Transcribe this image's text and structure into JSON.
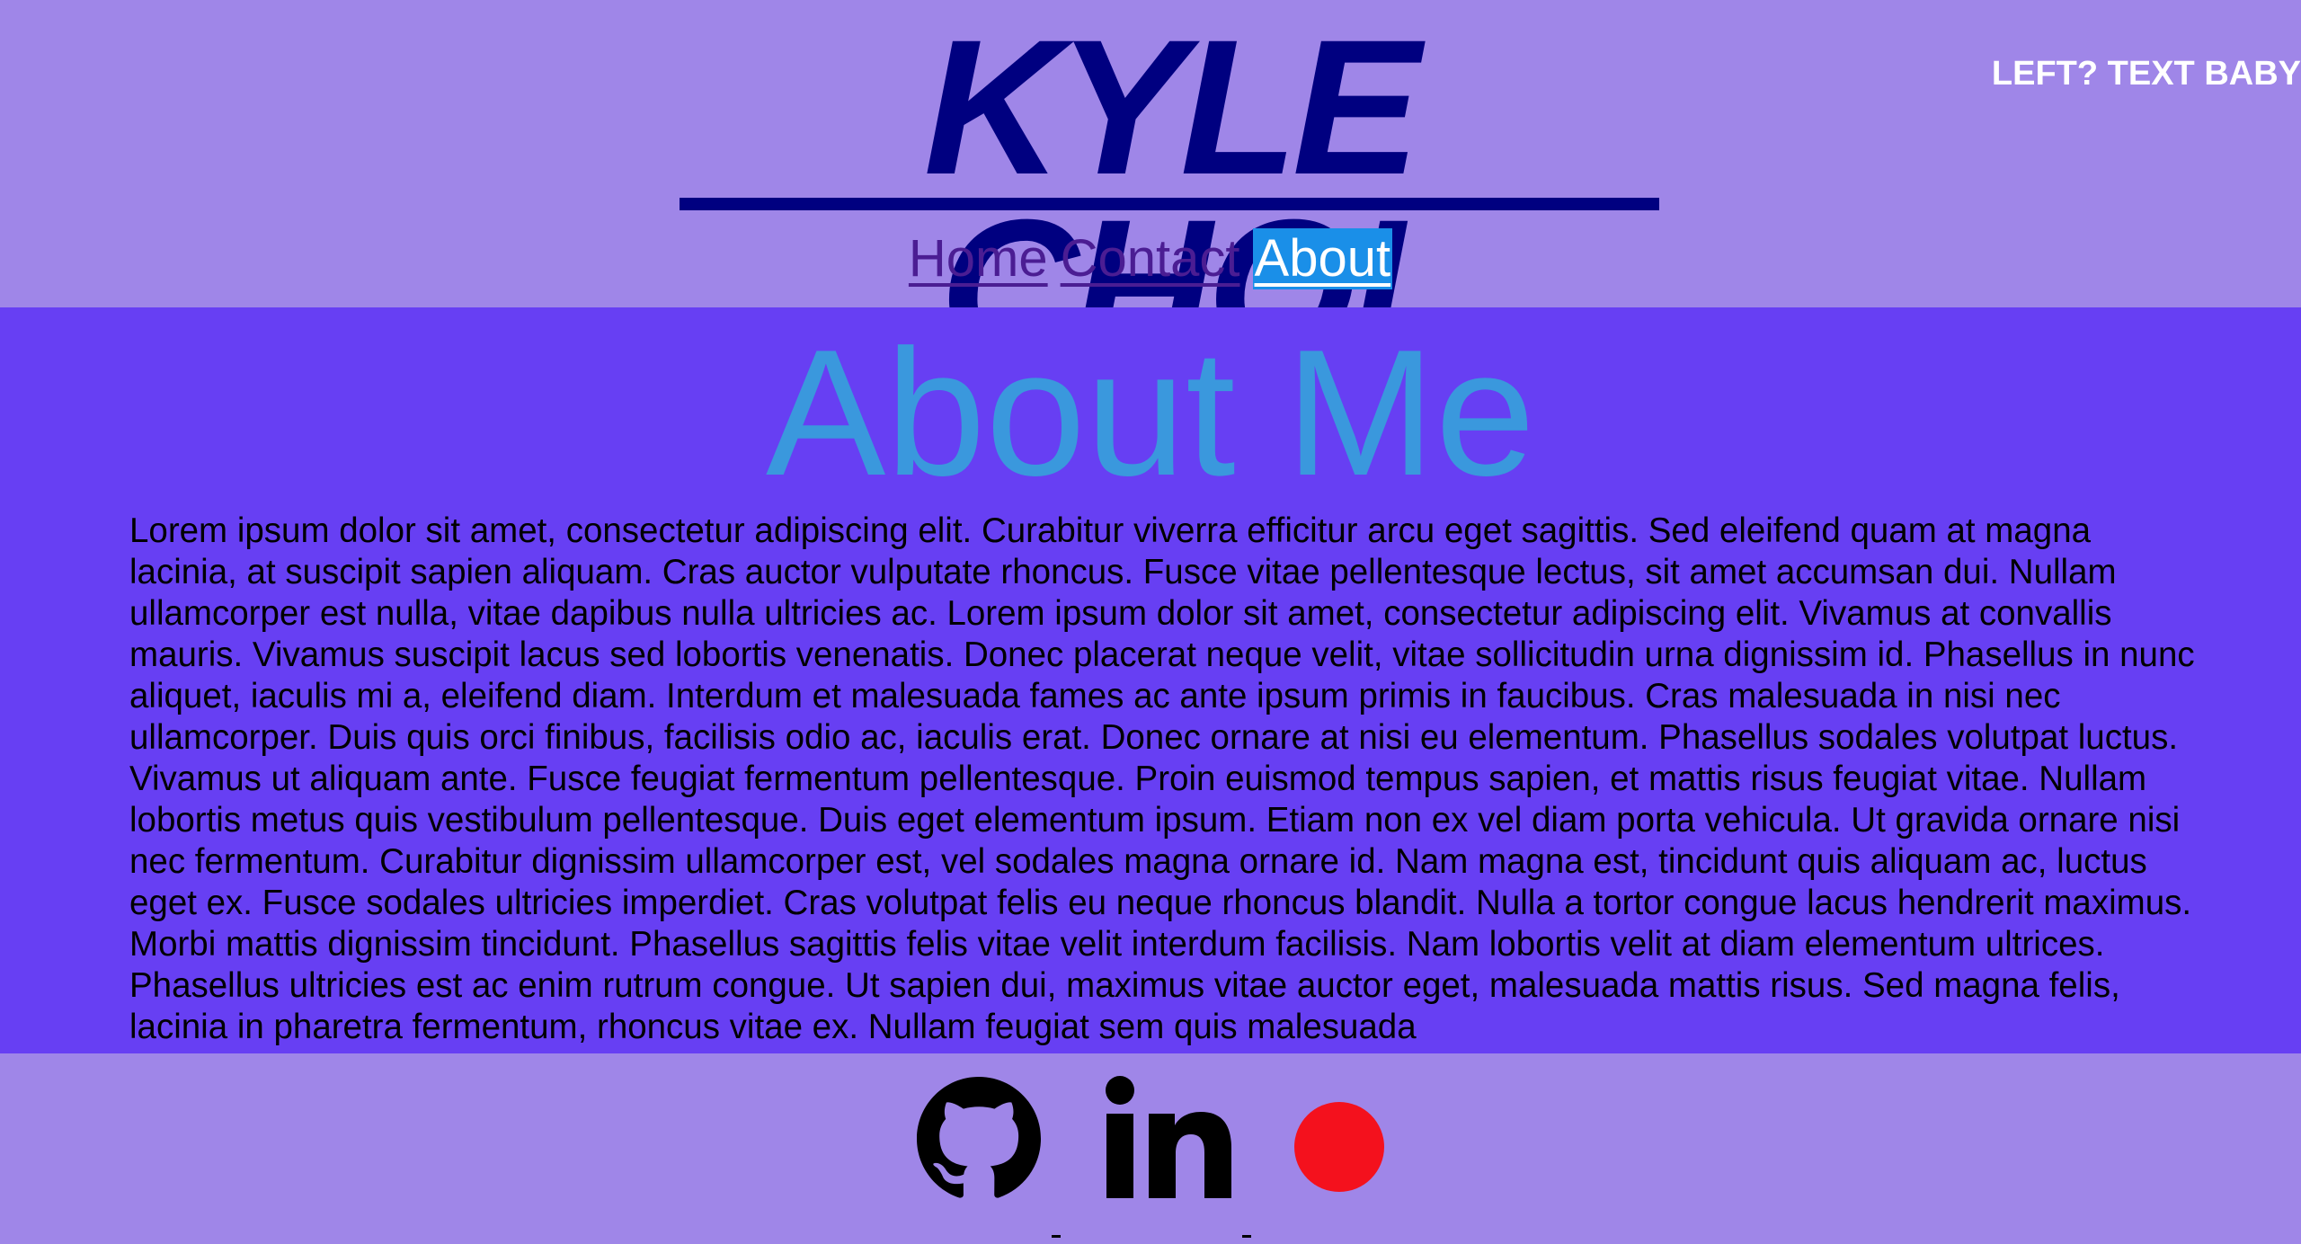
{
  "header": {
    "title": "KYLE CHOI",
    "corner_text": "LEFT? TEXT BABY",
    "nav": [
      {
        "label": "Home",
        "active": false
      },
      {
        "label": "Contact",
        "active": false
      },
      {
        "label": "About",
        "active": true
      }
    ]
  },
  "main": {
    "heading": "About Me",
    "body": "Lorem ipsum dolor sit amet, consectetur adipiscing elit. Curabitur viverra efficitur arcu eget sagittis. Sed eleifend quam at magna lacinia, at suscipit sapien aliquam. Cras auctor vulputate rhoncus. Fusce vitae pellentesque lectus, sit amet accumsan dui. Nullam ullamcorper est nulla, vitae dapibus nulla ultricies ac. Lorem ipsum dolor sit amet, consectetur adipiscing elit. Vivamus at convallis mauris. Vivamus suscipit lacus sed lobortis venenatis. Donec placerat neque velit, vitae sollicitudin urna dignissim id. Phasellus in nunc aliquet, iaculis mi a, eleifend diam. Interdum et malesuada fames ac ante ipsum primis in faucibus. Cras malesuada in nisi nec ullamcorper. Duis quis orci finibus, facilisis odio ac, iaculis erat. Donec ornare at nisi eu elementum. Phasellus sodales volutpat luctus. Vivamus ut aliquam ante. Fusce feugiat fermentum pellentesque. Proin euismod tempus sapien, et mattis risus feugiat vitae. Nullam lobortis metus quis vestibulum pellentesque. Duis eget elementum ipsum. Etiam non ex vel diam porta vehicula. Ut gravida ornare nisi nec fermentum. Curabitur dignissim ullamcorper est, vel sodales magna ornare id. Nam magna est, tincidunt quis aliquam ac, luctus eget ex. Fusce sodales ultricies imperdiet. Cras volutpat felis eu neque rhoncus blandit. Nulla a tortor congue lacus hendrerit maximus. Morbi mattis dignissim tincidunt. Phasellus sagittis felis vitae velit interdum facilisis. Nam lobortis velit at diam elementum ultrices. Phasellus ultricies est ac enim rutrum congue. Ut sapien dui, maximus vitae auctor eget, malesuada mattis risus. Sed magna felis, lacinia in pharetra fermentum, rhoncus vitae ex. Nullam feugiat sem quis malesuada"
  },
  "footer": {
    "icons": [
      "github-icon",
      "linkedin-icon",
      "record-icon"
    ]
  },
  "colors": {
    "page_background": "#9f86e8",
    "main_background": "#673ff3",
    "title": "#000080",
    "heading": "#3a98dd",
    "nav_link": "#4b1d93",
    "nav_active_bg": "#1a8fe8",
    "record_dot": "#f4111d"
  }
}
